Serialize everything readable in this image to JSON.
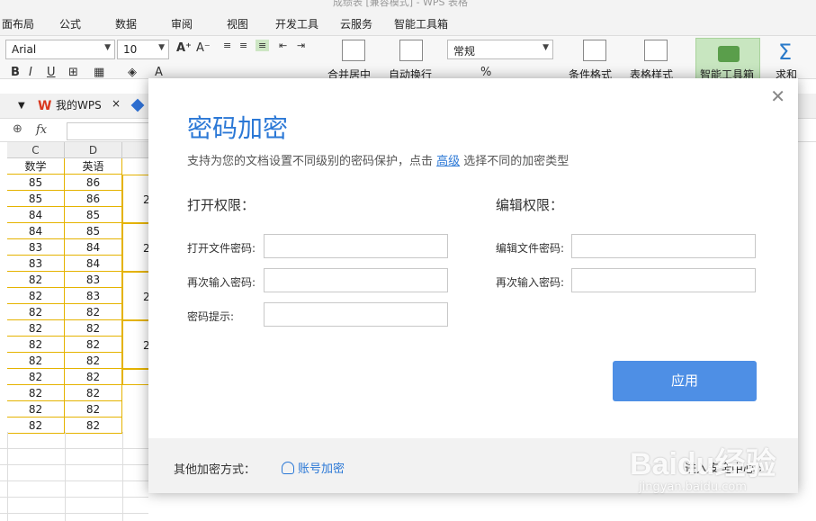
{
  "menu": {
    "title_ghost": "成绩表    [兼容模式]  - WPS 表格",
    "items": [
      "面布局",
      "公式",
      "数据",
      "审阅",
      "视图",
      "开发工具",
      "云服务",
      "智能工具箱"
    ]
  },
  "ribbon": {
    "font_name": "Arial",
    "font_size": "10",
    "number_format": "常规",
    "merge_label": "合并居中",
    "wrap_label": "自动换行",
    "cond_format_label": "条件格式",
    "table_style_label": "表格样式",
    "smart_tools_label": "智能工具箱",
    "sum_label": "求和",
    "bold": "B",
    "italic": "I",
    "underline": "U",
    "grow_font": "A⁺",
    "shrink_font": "A⁻",
    "percent": "%"
  },
  "tabs": {
    "home_tab": "我的WPS",
    "close": "×"
  },
  "formula_bar": {
    "fx": "fx"
  },
  "grid": {
    "col_headers": [
      "C",
      "D"
    ],
    "header_row": [
      "数学",
      "英语"
    ],
    "rows": [
      [
        "85",
        "86"
      ],
      [
        "85",
        "86"
      ],
      [
        "84",
        "85"
      ],
      [
        "84",
        "85"
      ],
      [
        "83",
        "84"
      ],
      [
        "83",
        "84"
      ],
      [
        "82",
        "83"
      ],
      [
        "82",
        "83"
      ],
      [
        "82",
        "82"
      ],
      [
        "82",
        "82"
      ],
      [
        "82",
        "82"
      ],
      [
        "82",
        "82"
      ],
      [
        "82",
        "82"
      ],
      [
        "82",
        "82"
      ],
      [
        "82",
        "82"
      ],
      [
        "82",
        "82"
      ]
    ],
    "merged_value": "2"
  },
  "dialog": {
    "title": "密码加密",
    "subtitle_before": "支持为您的文档设置不同级别的密码保护，点击 ",
    "subtitle_link": "高级",
    "subtitle_after": " 选择不同的加密类型",
    "open_section": "打开权限：",
    "edit_section": "编辑权限：",
    "open_password_label": "打开文件密码:",
    "open_confirm_label": "再次输入密码:",
    "hint_label": "密码提示:",
    "edit_password_label": "编辑文件密码:",
    "edit_confirm_label": "再次输入密码:",
    "apply": "应用",
    "other_methods": "其他加密方式：",
    "account_encrypt": "账号加密",
    "security_center": "进入安全中心",
    "close": "✕"
  },
  "watermark": {
    "main": "Baidu经验",
    "sub": "jingyan.baidu.com"
  }
}
